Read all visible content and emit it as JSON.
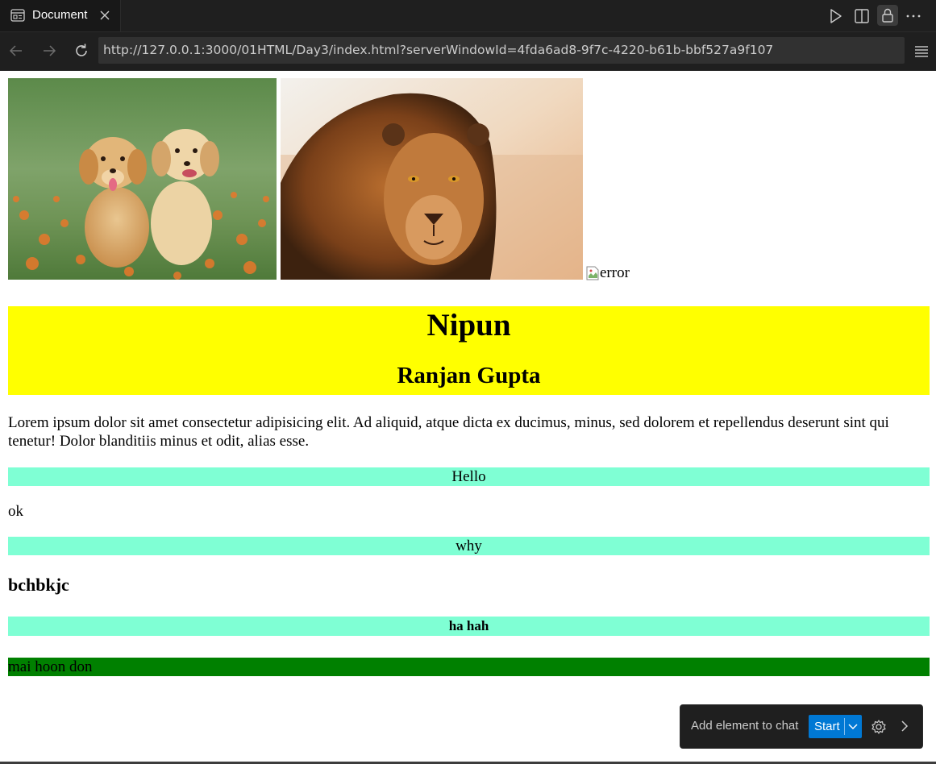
{
  "browser": {
    "tab_label": "Document",
    "url": "http://127.0.0.1:3000/01HTML/Day3/index.html?serverWindowId=4fda6ad8-9f7c-4220-b61b-bbf527a9f107"
  },
  "page": {
    "broken_image_alt": "error",
    "heading1": "Nipun",
    "heading2": "Ranjan Gupta",
    "paragraph": "Lorem ipsum dolor sit amet consectetur adipisicing elit. Ad aliquid, atque dicta ex ducimus, minus, sed dolorem et repellendus deserunt sint qui tenetur! Dolor blanditiis minus et odit, alias esse.",
    "bar1": "Hello",
    "text_ok": "ok",
    "bar2": "why",
    "heading3": "bchbkjc",
    "bar3": "ha hah",
    "green_bar": "mai hoon don"
  },
  "widget": {
    "label": "Add element to chat",
    "start_label": "Start"
  },
  "colors": {
    "yellow_header": "#ffff00",
    "aquamarine_bar": "#7fffd4",
    "green_bar": "#008000",
    "accent_button": "#0078d4"
  },
  "icons": {
    "tab": "browser-page-icon",
    "close": "close-icon",
    "run": "play-icon",
    "split": "split-editor-icon",
    "lock": "lock-icon",
    "more": "more-icon",
    "back": "back-arrow-icon",
    "forward": "forward-arrow-icon",
    "reload": "reload-icon",
    "menu": "hamburger-menu-icon",
    "settings": "gear-icon",
    "next": "chevron-right-icon"
  }
}
